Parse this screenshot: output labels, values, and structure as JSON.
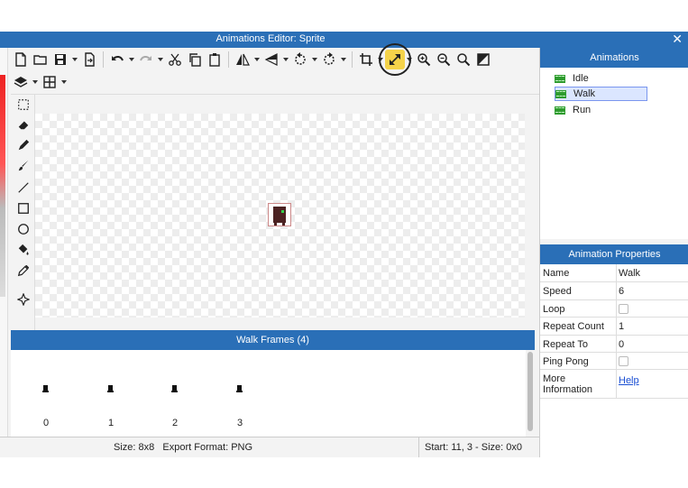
{
  "window": {
    "title": "Animations Editor: Sprite",
    "close_glyph": "✕"
  },
  "toolbar": {
    "row1": [
      "new-file-icon",
      "open-folder-icon",
      "save-icon",
      "export-icon",
      "undo-icon",
      "redo-icon",
      "cut-icon",
      "copy-icon",
      "paste-icon",
      "flip-horizontal-icon",
      "flip-vertical-icon",
      "rotate-left-icon",
      "rotate-right-icon",
      "crop-icon",
      "resize-icon",
      "zoom-in-icon",
      "zoom-out-icon",
      "zoom-fit-icon",
      "toggle-background-icon"
    ],
    "row2": [
      "layers-icon",
      "grid-icon"
    ],
    "highlighted": "resize-icon"
  },
  "tools": [
    "select-icon",
    "eraser-icon",
    "pencil-icon",
    "brush-icon",
    "line-icon",
    "rectangle-icon",
    "ellipse-icon",
    "fill-icon",
    "eyedropper-icon",
    "symmetry-icon"
  ],
  "frames": {
    "header": "Walk Frames (4)",
    "items": [
      {
        "label": "0"
      },
      {
        "label": "1"
      },
      {
        "label": "2"
      },
      {
        "label": "3"
      }
    ]
  },
  "status": {
    "left": "Size: 8x8   Export Format: PNG",
    "right": "Start: 11, 3 - Size: 0x0"
  },
  "animations": {
    "header": "Animations",
    "items": [
      {
        "label": "Idle"
      },
      {
        "label": "Walk",
        "selected": true
      },
      {
        "label": "Run"
      }
    ]
  },
  "properties": {
    "header": "Animation Properties",
    "rows": [
      {
        "key": "Name",
        "value": "Walk"
      },
      {
        "key": "Speed",
        "value": "6"
      },
      {
        "key": "Loop",
        "value": ""
      },
      {
        "key": "Repeat Count",
        "value": "1"
      },
      {
        "key": "Repeat To",
        "value": "0"
      },
      {
        "key": "Ping Pong",
        "value": ""
      },
      {
        "key": "More Information",
        "value": "Help"
      }
    ]
  },
  "colors": {
    "accent": "#2a6fb7",
    "highlight": "#f5d34a",
    "selection": "#dbe6ff"
  }
}
